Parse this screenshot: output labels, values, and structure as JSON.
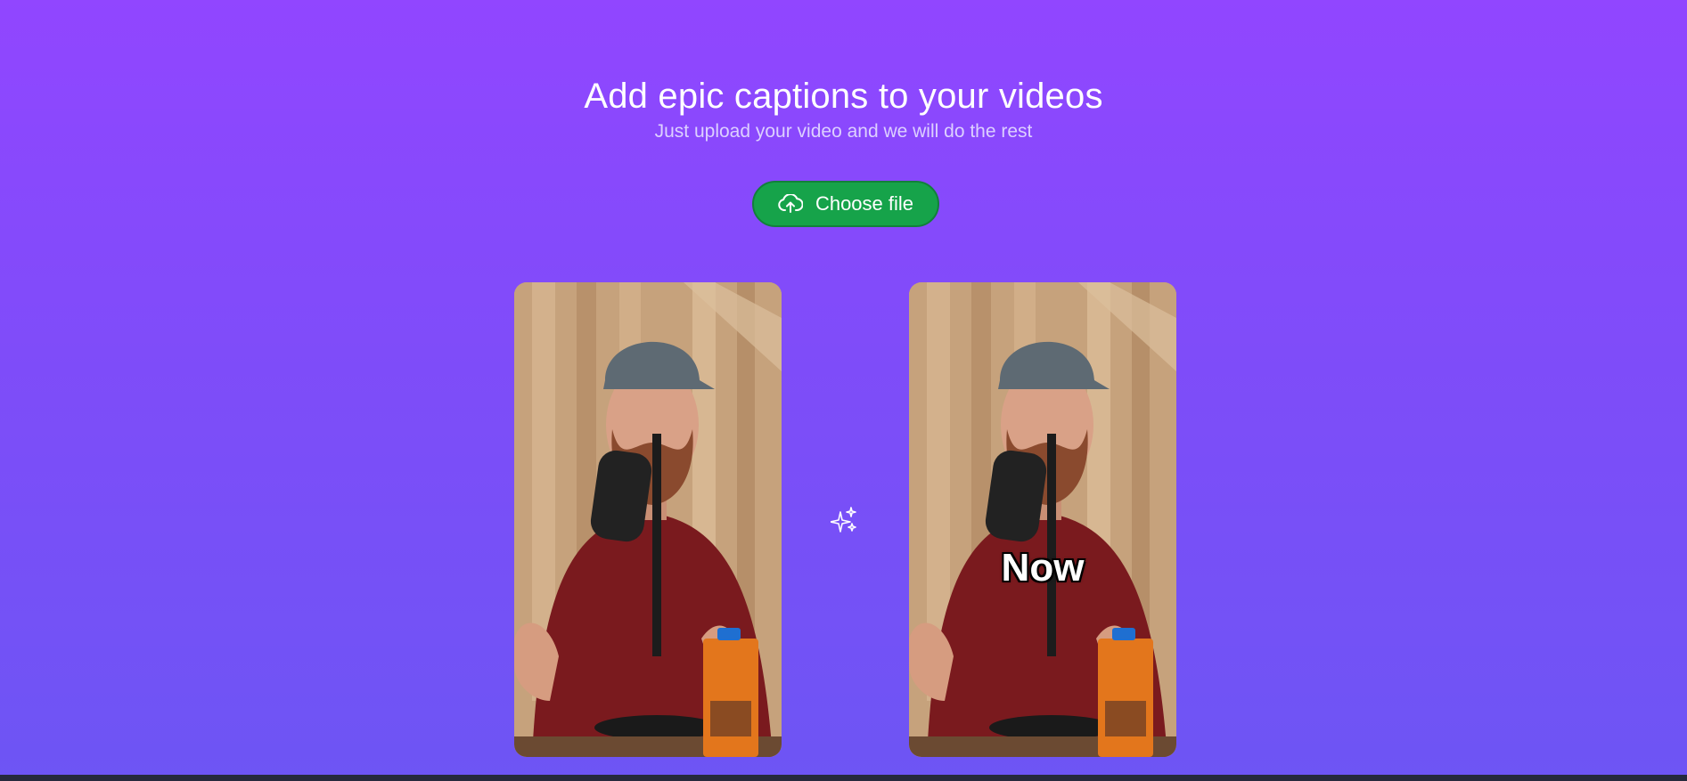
{
  "header": {
    "title": "Add epic captions to your videos",
    "subtitle": "Just upload your video and we will do the rest"
  },
  "upload": {
    "label": "Choose file",
    "icon": "cloud-upload-icon"
  },
  "videos": {
    "original": {
      "caption": ""
    },
    "captioned": {
      "caption": "Now"
    }
  },
  "divider_icon": "sparkles-icon",
  "colors": {
    "background_top": "#9146ff",
    "background_bottom": "#6d55f4",
    "button": "#16a34a",
    "text": "#ffffff"
  }
}
